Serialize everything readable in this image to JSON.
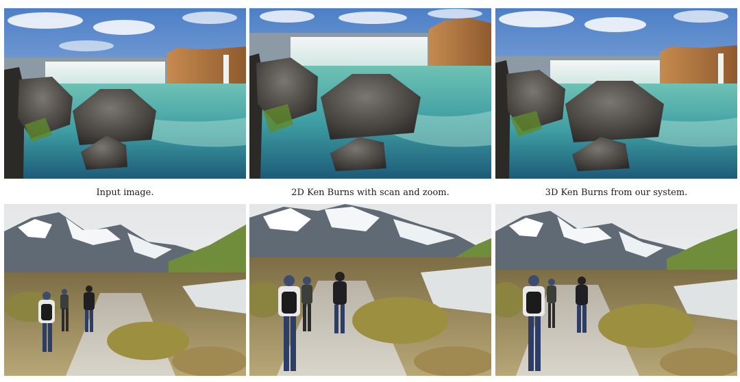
{
  "figure": {
    "captions": [
      "Input image.",
      "2D Ken Burns with scan and zoom.",
      "3D Ken Burns from our system."
    ]
  }
}
